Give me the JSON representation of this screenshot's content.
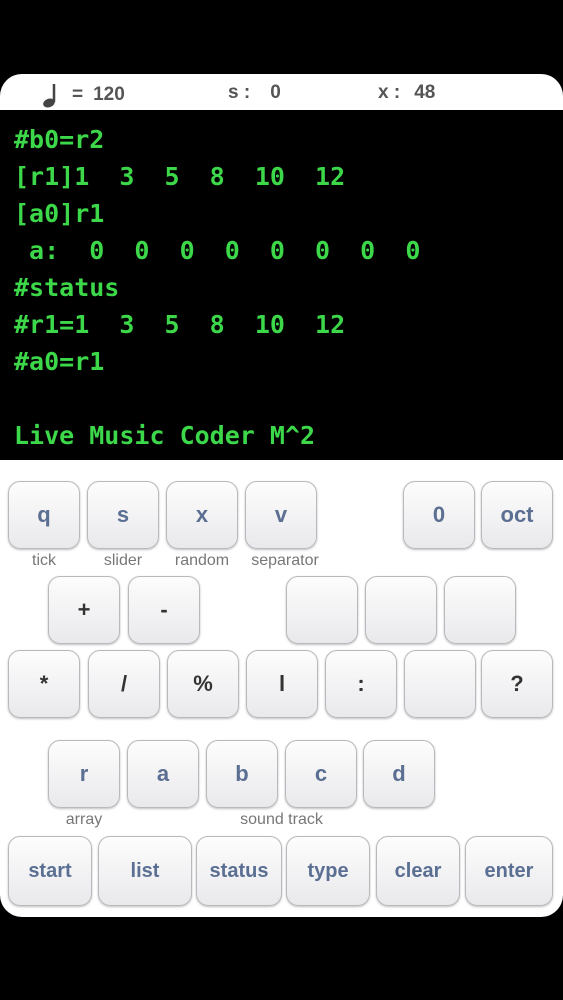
{
  "status": {
    "tempo_value": "120",
    "s_label": "s :",
    "s_value": "0",
    "x_label": "x :",
    "x_value": "48"
  },
  "console": {
    "lines": [
      "#b0=r2",
      "[r1]1  3  5  8  10  12",
      "[a0]r1",
      " a:  0  0  0  0  0  0  0  0",
      "#status",
      "#r1=1  3  5  8  10  12",
      "#a0=r1",
      "",
      "Live Music Coder M^2"
    ]
  },
  "keys": {
    "q": "q",
    "s": "s",
    "x": "x",
    "v": "v",
    "zero": "0",
    "oct": "oct",
    "plus": "+",
    "minus": "-",
    "star": "*",
    "slash": "/",
    "percent": "%",
    "pipe": "l",
    "colon": ":",
    "question": "?",
    "r": "r",
    "a": "a",
    "b": "b",
    "c": "c",
    "d": "d",
    "start": "start",
    "list": "list",
    "status": "status",
    "type": "type",
    "clear": "clear",
    "enter": "enter"
  },
  "captions": {
    "tick": "tick",
    "slider": "slider",
    "random": "random",
    "separator": "separator",
    "array": "array",
    "sound_track": "sound track"
  }
}
